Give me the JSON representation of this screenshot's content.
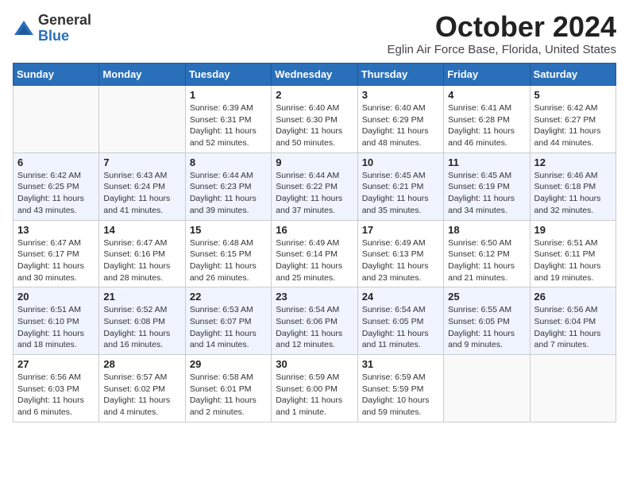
{
  "header": {
    "logo_line1": "General",
    "logo_line2": "Blue",
    "month": "October 2024",
    "location": "Eglin Air Force Base, Florida, United States"
  },
  "weekdays": [
    "Sunday",
    "Monday",
    "Tuesday",
    "Wednesday",
    "Thursday",
    "Friday",
    "Saturday"
  ],
  "weeks": [
    [
      null,
      null,
      {
        "day": "1",
        "sunrise": "Sunrise: 6:39 AM",
        "sunset": "Sunset: 6:31 PM",
        "daylight": "Daylight: 11 hours and 52 minutes."
      },
      {
        "day": "2",
        "sunrise": "Sunrise: 6:40 AM",
        "sunset": "Sunset: 6:30 PM",
        "daylight": "Daylight: 11 hours and 50 minutes."
      },
      {
        "day": "3",
        "sunrise": "Sunrise: 6:40 AM",
        "sunset": "Sunset: 6:29 PM",
        "daylight": "Daylight: 11 hours and 48 minutes."
      },
      {
        "day": "4",
        "sunrise": "Sunrise: 6:41 AM",
        "sunset": "Sunset: 6:28 PM",
        "daylight": "Daylight: 11 hours and 46 minutes."
      },
      {
        "day": "5",
        "sunrise": "Sunrise: 6:42 AM",
        "sunset": "Sunset: 6:27 PM",
        "daylight": "Daylight: 11 hours and 44 minutes."
      }
    ],
    [
      {
        "day": "6",
        "sunrise": "Sunrise: 6:42 AM",
        "sunset": "Sunset: 6:25 PM",
        "daylight": "Daylight: 11 hours and 43 minutes."
      },
      {
        "day": "7",
        "sunrise": "Sunrise: 6:43 AM",
        "sunset": "Sunset: 6:24 PM",
        "daylight": "Daylight: 11 hours and 41 minutes."
      },
      {
        "day": "8",
        "sunrise": "Sunrise: 6:44 AM",
        "sunset": "Sunset: 6:23 PM",
        "daylight": "Daylight: 11 hours and 39 minutes."
      },
      {
        "day": "9",
        "sunrise": "Sunrise: 6:44 AM",
        "sunset": "Sunset: 6:22 PM",
        "daylight": "Daylight: 11 hours and 37 minutes."
      },
      {
        "day": "10",
        "sunrise": "Sunrise: 6:45 AM",
        "sunset": "Sunset: 6:21 PM",
        "daylight": "Daylight: 11 hours and 35 minutes."
      },
      {
        "day": "11",
        "sunrise": "Sunrise: 6:45 AM",
        "sunset": "Sunset: 6:19 PM",
        "daylight": "Daylight: 11 hours and 34 minutes."
      },
      {
        "day": "12",
        "sunrise": "Sunrise: 6:46 AM",
        "sunset": "Sunset: 6:18 PM",
        "daylight": "Daylight: 11 hours and 32 minutes."
      }
    ],
    [
      {
        "day": "13",
        "sunrise": "Sunrise: 6:47 AM",
        "sunset": "Sunset: 6:17 PM",
        "daylight": "Daylight: 11 hours and 30 minutes."
      },
      {
        "day": "14",
        "sunrise": "Sunrise: 6:47 AM",
        "sunset": "Sunset: 6:16 PM",
        "daylight": "Daylight: 11 hours and 28 minutes."
      },
      {
        "day": "15",
        "sunrise": "Sunrise: 6:48 AM",
        "sunset": "Sunset: 6:15 PM",
        "daylight": "Daylight: 11 hours and 26 minutes."
      },
      {
        "day": "16",
        "sunrise": "Sunrise: 6:49 AM",
        "sunset": "Sunset: 6:14 PM",
        "daylight": "Daylight: 11 hours and 25 minutes."
      },
      {
        "day": "17",
        "sunrise": "Sunrise: 6:49 AM",
        "sunset": "Sunset: 6:13 PM",
        "daylight": "Daylight: 11 hours and 23 minutes."
      },
      {
        "day": "18",
        "sunrise": "Sunrise: 6:50 AM",
        "sunset": "Sunset: 6:12 PM",
        "daylight": "Daylight: 11 hours and 21 minutes."
      },
      {
        "day": "19",
        "sunrise": "Sunrise: 6:51 AM",
        "sunset": "Sunset: 6:11 PM",
        "daylight": "Daylight: 11 hours and 19 minutes."
      }
    ],
    [
      {
        "day": "20",
        "sunrise": "Sunrise: 6:51 AM",
        "sunset": "Sunset: 6:10 PM",
        "daylight": "Daylight: 11 hours and 18 minutes."
      },
      {
        "day": "21",
        "sunrise": "Sunrise: 6:52 AM",
        "sunset": "Sunset: 6:08 PM",
        "daylight": "Daylight: 11 hours and 16 minutes."
      },
      {
        "day": "22",
        "sunrise": "Sunrise: 6:53 AM",
        "sunset": "Sunset: 6:07 PM",
        "daylight": "Daylight: 11 hours and 14 minutes."
      },
      {
        "day": "23",
        "sunrise": "Sunrise: 6:54 AM",
        "sunset": "Sunset: 6:06 PM",
        "daylight": "Daylight: 11 hours and 12 minutes."
      },
      {
        "day": "24",
        "sunrise": "Sunrise: 6:54 AM",
        "sunset": "Sunset: 6:05 PM",
        "daylight": "Daylight: 11 hours and 11 minutes."
      },
      {
        "day": "25",
        "sunrise": "Sunrise: 6:55 AM",
        "sunset": "Sunset: 6:05 PM",
        "daylight": "Daylight: 11 hours and 9 minutes."
      },
      {
        "day": "26",
        "sunrise": "Sunrise: 6:56 AM",
        "sunset": "Sunset: 6:04 PM",
        "daylight": "Daylight: 11 hours and 7 minutes."
      }
    ],
    [
      {
        "day": "27",
        "sunrise": "Sunrise: 6:56 AM",
        "sunset": "Sunset: 6:03 PM",
        "daylight": "Daylight: 11 hours and 6 minutes."
      },
      {
        "day": "28",
        "sunrise": "Sunrise: 6:57 AM",
        "sunset": "Sunset: 6:02 PM",
        "daylight": "Daylight: 11 hours and 4 minutes."
      },
      {
        "day": "29",
        "sunrise": "Sunrise: 6:58 AM",
        "sunset": "Sunset: 6:01 PM",
        "daylight": "Daylight: 11 hours and 2 minutes."
      },
      {
        "day": "30",
        "sunrise": "Sunrise: 6:59 AM",
        "sunset": "Sunset: 6:00 PM",
        "daylight": "Daylight: 11 hours and 1 minute."
      },
      {
        "day": "31",
        "sunrise": "Sunrise: 6:59 AM",
        "sunset": "Sunset: 5:59 PM",
        "daylight": "Daylight: 10 hours and 59 minutes."
      },
      null,
      null
    ]
  ]
}
